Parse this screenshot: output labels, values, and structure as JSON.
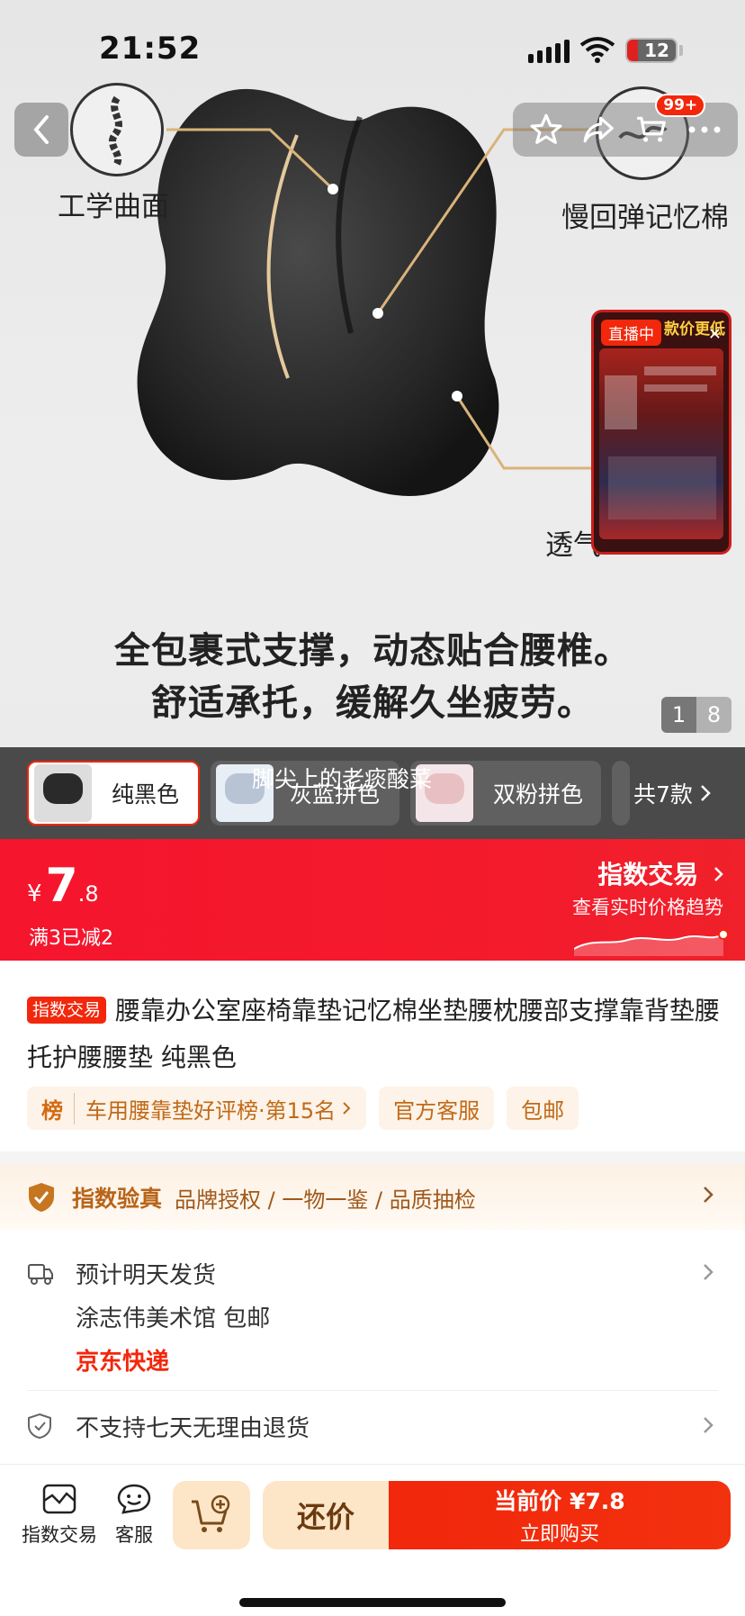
{
  "status_bar": {
    "time": "21:52",
    "battery": "12"
  },
  "nav": {
    "cart_badge": "99+"
  },
  "hero": {
    "feature_left": "工学曲面",
    "feature_right": "慢回弹记忆棉",
    "feature_bottom": "透气",
    "headline_line1": "全包裹式支撑，动态贴合腰椎。",
    "headline_line2": "舒适承托，缓解久坐疲劳。",
    "page_current": "1",
    "page_total": "8",
    "live_tag": "直播中",
    "live_title": "款价更低"
  },
  "variants": {
    "items": [
      {
        "label": "纯黑色",
        "color": "#2a2a2a"
      },
      {
        "label": "灰蓝拼色",
        "color": "#b8c4d4"
      },
      {
        "label": "双粉拼色",
        "color": "#e8c0c4"
      }
    ],
    "count_label": "共7款",
    "overlay_text": "脚尖上的老痰酸菜"
  },
  "price": {
    "currency": "¥",
    "integer": "7",
    "decimal": ".8",
    "promo": "满3已减2",
    "index_trade_label": "指数交易",
    "index_trade_sub": "查看实时价格趋势"
  },
  "product": {
    "tag": "指数交易",
    "title": "腰靠办公室座椅靠垫记忆棉坐垫腰枕腰部支撑靠背垫腰托护腰腰垫 纯黑色",
    "rank_icon": "榜",
    "rank_text": "车用腰靠垫好评榜·第15名",
    "service_chip": "官方客服",
    "shipping_chip": "包邮"
  },
  "verify": {
    "title": "指数验真",
    "desc": "品牌授权 / 一物一鉴 / 品质抽检"
  },
  "shipping": {
    "line1": "预计明天发货",
    "line2": "涂志伟美术馆 包邮",
    "line3": "京东快递",
    "returns": "不支持七天无理由退货"
  },
  "bottom_bar": {
    "index_trade": "指数交易",
    "service": "客服",
    "bargain": "还价",
    "buy_price_label": "当前价 ¥7.8",
    "buy_now": "立即购买"
  },
  "colors": {
    "accent": "#f2270c",
    "gold": "#c06a18"
  }
}
